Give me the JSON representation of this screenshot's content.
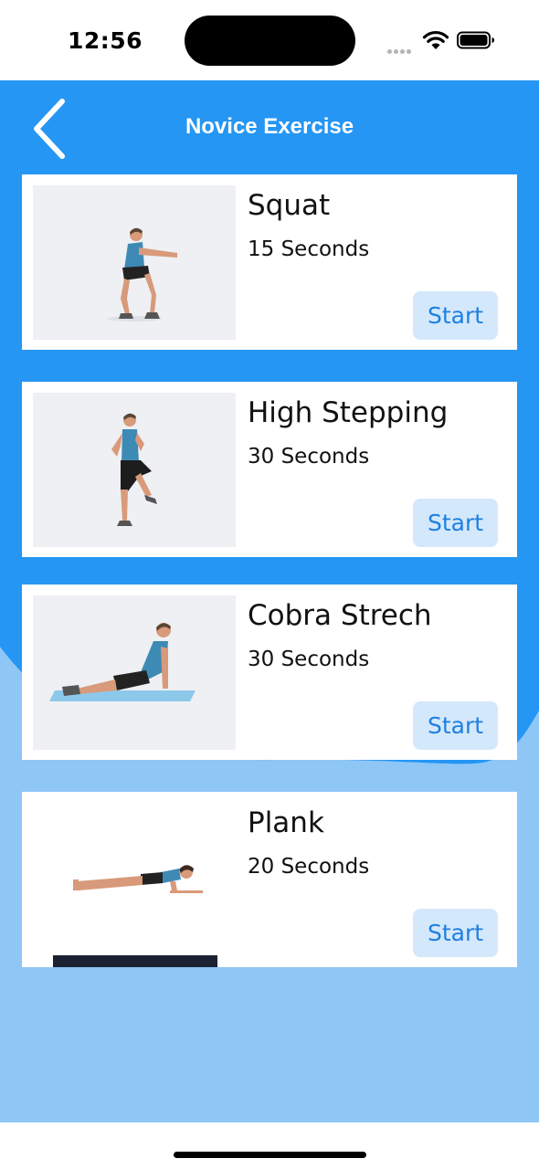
{
  "status_bar": {
    "time": "12:56",
    "icons": [
      "signal-icon",
      "wifi-icon",
      "battery-icon"
    ]
  },
  "nav": {
    "title": "Novice Exercise",
    "back_icon": "chevron-left-icon"
  },
  "colors": {
    "header_blue": "#2596f3",
    "background_light_blue": "#8ec6f6",
    "start_button_bg": "#d4e8fc",
    "start_button_text": "#1e7fe0"
  },
  "exercises": [
    {
      "name": "Squat",
      "duration": "15 Seconds",
      "start_label": "Start"
    },
    {
      "name": "High Stepping",
      "duration": "30 Seconds",
      "start_label": "Start"
    },
    {
      "name": "Cobra Strech",
      "duration": "30 Seconds",
      "start_label": "Start"
    },
    {
      "name": "Plank",
      "duration": "20 Seconds",
      "start_label": "Start"
    }
  ]
}
